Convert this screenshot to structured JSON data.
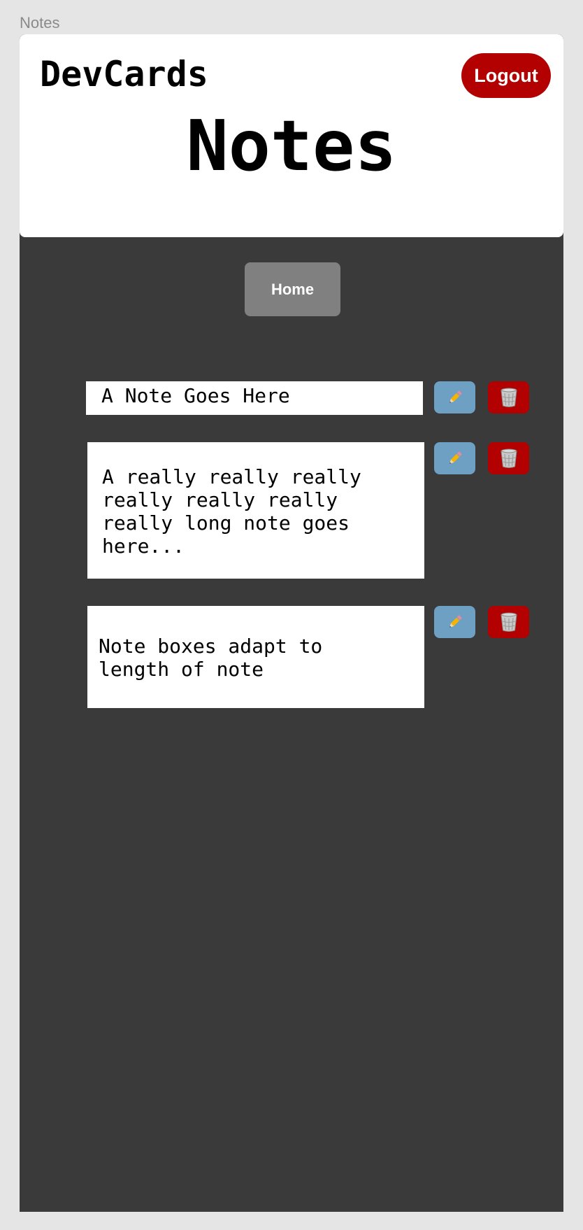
{
  "frame_label": "Notes",
  "header": {
    "brand": "DevCards",
    "title": "Notes",
    "logout_label": "Logout"
  },
  "nav": {
    "home_label": "Home"
  },
  "notes": [
    {
      "text": "A Note Goes Here"
    },
    {
      "text": "A really really really\nreally really really\nreally long note goes\nhere..."
    },
    {
      "text": "Note boxes adapt to\nlength of note"
    }
  ],
  "icons": {
    "edit": "pencil-icon",
    "delete": "trash-icon"
  },
  "colors": {
    "background": "#3a3a3a",
    "header": "#ffffff",
    "logout": "#b30000",
    "home": "#808080",
    "edit": "#6da0c3",
    "delete": "#b30000"
  }
}
